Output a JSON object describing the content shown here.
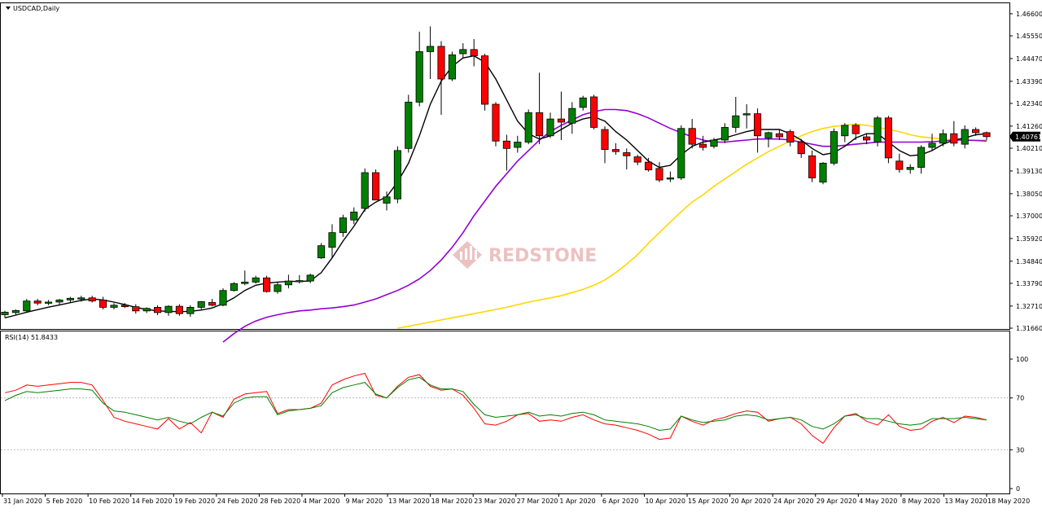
{
  "chart_title": "USDCAD,Daily",
  "rsi_label": "RSI(14) 51.8433",
  "watermark": "REDSTONE",
  "current_price": "1.40761",
  "colors": {
    "bull": "#008000",
    "bear": "#ff0000",
    "ma_fast": "#000000",
    "ma_mid": "#9400d3",
    "ma_slow": "#ffd700",
    "rsi": "#008000",
    "rsi_ma": "#ff0000",
    "watermark": "#e8a0a0"
  },
  "chart_data": [
    {
      "type": "candlestick",
      "title": "USDCAD,Daily",
      "ylim": [
        1.3166,
        1.4706
      ],
      "y_ticks": [
        "1.46600",
        "1.45550",
        "1.44470",
        "1.43390",
        "1.42340",
        "1.41260",
        "1.40210",
        "1.39130",
        "1.38050",
        "1.37000",
        "1.35920",
        "1.34840",
        "1.33790",
        "1.32710",
        "1.31660"
      ],
      "x_ticks": [
        "31 Jan 2020",
        "5 Feb 2020",
        "10 Feb 2020",
        "14 Feb 2020",
        "19 Feb 2020",
        "24 Feb 2020",
        "28 Feb 2020",
        "4 Mar 2020",
        "9 Mar 2020",
        "13 Mar 2020",
        "18 Mar 2020",
        "23 Mar 2020",
        "27 Mar 2020",
        "1 Apr 2020",
        "6 Apr 2020",
        "10 Apr 2020",
        "15 Apr 2020",
        "20 Apr 2020",
        "24 Apr 2020",
        "29 Apr 2020",
        "4 May 2020",
        "8 May 2020",
        "13 May 2020",
        "18 May 2020"
      ],
      "candles": [
        {
          "o": 1.323,
          "h": 1.3248,
          "l": 1.3215,
          "c": 1.3242
        },
        {
          "o": 1.324,
          "h": 1.3255,
          "l": 1.323,
          "c": 1.325
        },
        {
          "o": 1.3248,
          "h": 1.3305,
          "l": 1.324,
          "c": 1.3295
        },
        {
          "o": 1.3295,
          "h": 1.3305,
          "l": 1.3275,
          "c": 1.3285
        },
        {
          "o": 1.3285,
          "h": 1.33,
          "l": 1.3275,
          "c": 1.329
        },
        {
          "o": 1.329,
          "h": 1.3305,
          "l": 1.3278,
          "c": 1.33
        },
        {
          "o": 1.33,
          "h": 1.3315,
          "l": 1.3288,
          "c": 1.3308
        },
        {
          "o": 1.3305,
          "h": 1.332,
          "l": 1.3292,
          "c": 1.331
        },
        {
          "o": 1.331,
          "h": 1.332,
          "l": 1.3288,
          "c": 1.3295
        },
        {
          "o": 1.33,
          "h": 1.3315,
          "l": 1.3255,
          "c": 1.3265
        },
        {
          "o": 1.3265,
          "h": 1.3285,
          "l": 1.3255,
          "c": 1.3275
        },
        {
          "o": 1.3275,
          "h": 1.3285,
          "l": 1.3262,
          "c": 1.3268
        },
        {
          "o": 1.3268,
          "h": 1.328,
          "l": 1.3235,
          "c": 1.3248
        },
        {
          "o": 1.3248,
          "h": 1.3265,
          "l": 1.3238,
          "c": 1.326
        },
        {
          "o": 1.3265,
          "h": 1.3275,
          "l": 1.3228,
          "c": 1.324
        },
        {
          "o": 1.324,
          "h": 1.3275,
          "l": 1.3225,
          "c": 1.327
        },
        {
          "o": 1.327,
          "h": 1.328,
          "l": 1.3225,
          "c": 1.3235
        },
        {
          "o": 1.3235,
          "h": 1.3275,
          "l": 1.322,
          "c": 1.3265
        },
        {
          "o": 1.3265,
          "h": 1.3295,
          "l": 1.3255,
          "c": 1.3292
        },
        {
          "o": 1.3288,
          "h": 1.3305,
          "l": 1.327,
          "c": 1.3275
        },
        {
          "o": 1.3275,
          "h": 1.3355,
          "l": 1.327,
          "c": 1.3345
        },
        {
          "o": 1.3345,
          "h": 1.3385,
          "l": 1.334,
          "c": 1.3378
        },
        {
          "o": 1.3378,
          "h": 1.344,
          "l": 1.337,
          "c": 1.3385
        },
        {
          "o": 1.3385,
          "h": 1.3415,
          "l": 1.3378,
          "c": 1.3405
        },
        {
          "o": 1.3405,
          "h": 1.3415,
          "l": 1.3335,
          "c": 1.334
        },
        {
          "o": 1.334,
          "h": 1.3385,
          "l": 1.333,
          "c": 1.3372
        },
        {
          "o": 1.3372,
          "h": 1.342,
          "l": 1.3355,
          "c": 1.339
        },
        {
          "o": 1.3388,
          "h": 1.3418,
          "l": 1.3378,
          "c": 1.3392
        },
        {
          "o": 1.339,
          "h": 1.3425,
          "l": 1.338,
          "c": 1.3418
        },
        {
          "o": 1.35,
          "h": 1.357,
          "l": 1.3495,
          "c": 1.3558
        },
        {
          "o": 1.355,
          "h": 1.366,
          "l": 1.35,
          "c": 1.362
        },
        {
          "o": 1.362,
          "h": 1.3705,
          "l": 1.36,
          "c": 1.369
        },
        {
          "o": 1.368,
          "h": 1.374,
          "l": 1.366,
          "c": 1.3718
        },
        {
          "o": 1.3735,
          "h": 1.3925,
          "l": 1.372,
          "c": 1.3905
        },
        {
          "o": 1.3905,
          "h": 1.392,
          "l": 1.378,
          "c": 1.3775
        },
        {
          "o": 1.376,
          "h": 1.3815,
          "l": 1.3725,
          "c": 1.379
        },
        {
          "o": 1.378,
          "h": 1.403,
          "l": 1.376,
          "c": 1.401
        },
        {
          "o": 1.402,
          "h": 1.4275,
          "l": 1.4,
          "c": 1.424
        },
        {
          "o": 1.424,
          "h": 1.4575,
          "l": 1.422,
          "c": 1.448
        },
        {
          "o": 1.448,
          "h": 1.46,
          "l": 1.435,
          "c": 1.4505
        },
        {
          "o": 1.4505,
          "h": 1.453,
          "l": 1.418,
          "c": 1.435
        },
        {
          "o": 1.435,
          "h": 1.448,
          "l": 1.434,
          "c": 1.4465
        },
        {
          "o": 1.447,
          "h": 1.452,
          "l": 1.445,
          "c": 1.449
        },
        {
          "o": 1.449,
          "h": 1.454,
          "l": 1.441,
          "c": 1.446
        },
        {
          "o": 1.446,
          "h": 1.447,
          "l": 1.42,
          "c": 1.423
        },
        {
          "o": 1.423,
          "h": 1.424,
          "l": 1.403,
          "c": 1.4055
        },
        {
          "o": 1.4055,
          "h": 1.4085,
          "l": 1.3915,
          "c": 1.402
        },
        {
          "o": 1.4025,
          "h": 1.408,
          "l": 1.4,
          "c": 1.405
        },
        {
          "o": 1.405,
          "h": 1.4205,
          "l": 1.404,
          "c": 1.419
        },
        {
          "o": 1.419,
          "h": 1.438,
          "l": 1.404,
          "c": 1.408
        },
        {
          "o": 1.408,
          "h": 1.419,
          "l": 1.407,
          "c": 1.416
        },
        {
          "o": 1.416,
          "h": 1.429,
          "l": 1.406,
          "c": 1.4145
        },
        {
          "o": 1.414,
          "h": 1.424,
          "l": 1.409,
          "c": 1.421
        },
        {
          "o": 1.4215,
          "h": 1.427,
          "l": 1.42,
          "c": 1.426
        },
        {
          "o": 1.4265,
          "h": 1.4275,
          "l": 1.411,
          "c": 1.412
        },
        {
          "o": 1.411,
          "h": 1.4125,
          "l": 1.395,
          "c": 1.4015
        },
        {
          "o": 1.4015,
          "h": 1.4045,
          "l": 1.399,
          "c": 1.4005
        },
        {
          "o": 1.4,
          "h": 1.402,
          "l": 1.392,
          "c": 1.3985
        },
        {
          "o": 1.398,
          "h": 1.399,
          "l": 1.394,
          "c": 1.3955
        },
        {
          "o": 1.3955,
          "h": 1.3975,
          "l": 1.391,
          "c": 1.3918
        },
        {
          "o": 1.3925,
          "h": 1.3955,
          "l": 1.386,
          "c": 1.387
        },
        {
          "o": 1.3875,
          "h": 1.391,
          "l": 1.386,
          "c": 1.388
        },
        {
          "o": 1.388,
          "h": 1.413,
          "l": 1.387,
          "c": 1.4115
        },
        {
          "o": 1.4115,
          "h": 1.416,
          "l": 1.402,
          "c": 1.404
        },
        {
          "o": 1.404,
          "h": 1.408,
          "l": 1.401,
          "c": 1.4025
        },
        {
          "o": 1.403,
          "h": 1.407,
          "l": 1.402,
          "c": 1.406
        },
        {
          "o": 1.406,
          "h": 1.414,
          "l": 1.4045,
          "c": 1.412
        },
        {
          "o": 1.412,
          "h": 1.4265,
          "l": 1.4095,
          "c": 1.4175
        },
        {
          "o": 1.418,
          "h": 1.423,
          "l": 1.4115,
          "c": 1.4185
        },
        {
          "o": 1.4185,
          "h": 1.421,
          "l": 1.4,
          "c": 1.408
        },
        {
          "o": 1.407,
          "h": 1.41,
          "l": 1.4025,
          "c": 1.4095
        },
        {
          "o": 1.409,
          "h": 1.411,
          "l": 1.406,
          "c": 1.4075
        },
        {
          "o": 1.41,
          "h": 1.411,
          "l": 1.403,
          "c": 1.405
        },
        {
          "o": 1.405,
          "h": 1.4065,
          "l": 1.3975,
          "c": 1.3995
        },
        {
          "o": 1.3985,
          "h": 1.401,
          "l": 1.386,
          "c": 1.388
        },
        {
          "o": 1.386,
          "h": 1.3955,
          "l": 1.385,
          "c": 1.395
        },
        {
          "o": 1.395,
          "h": 1.4115,
          "l": 1.394,
          "c": 1.41
        },
        {
          "o": 1.408,
          "h": 1.414,
          "l": 1.405,
          "c": 1.413
        },
        {
          "o": 1.413,
          "h": 1.414,
          "l": 1.406,
          "c": 1.409
        },
        {
          "o": 1.4075,
          "h": 1.409,
          "l": 1.404,
          "c": 1.406
        },
        {
          "o": 1.405,
          "h": 1.4175,
          "l": 1.403,
          "c": 1.4165
        },
        {
          "o": 1.4165,
          "h": 1.4175,
          "l": 1.395,
          "c": 1.3975
        },
        {
          "o": 1.396,
          "h": 1.3995,
          "l": 1.3905,
          "c": 1.392
        },
        {
          "o": 1.392,
          "h": 1.3945,
          "l": 1.39,
          "c": 1.393
        },
        {
          "o": 1.393,
          "h": 1.4035,
          "l": 1.39,
          "c": 1.4025
        },
        {
          "o": 1.4025,
          "h": 1.409,
          "l": 1.401,
          "c": 1.4045
        },
        {
          "o": 1.4045,
          "h": 1.411,
          "l": 1.403,
          "c": 1.409
        },
        {
          "o": 1.409,
          "h": 1.415,
          "l": 1.403,
          "c": 1.4045
        },
        {
          "o": 1.404,
          "h": 1.413,
          "l": 1.402,
          "c": 1.411
        },
        {
          "o": 1.411,
          "h": 1.412,
          "l": 1.408,
          "c": 1.4095
        },
        {
          "o": 1.4095,
          "h": 1.41,
          "l": 1.406,
          "c": 1.4076
        }
      ],
      "ma_fast": [
        1.3215,
        1.3228,
        1.3242,
        1.3254,
        1.3266,
        1.3276,
        1.3287,
        1.3298,
        1.3305,
        1.33,
        1.329,
        1.3278,
        1.3265,
        1.3255,
        1.3248,
        1.3246,
        1.3244,
        1.3246,
        1.3252,
        1.3262,
        1.3282,
        1.331,
        1.3345,
        1.337,
        1.338,
        1.3385,
        1.3388,
        1.3388,
        1.339,
        1.343,
        1.35,
        1.358,
        1.365,
        1.373,
        1.3765,
        1.379,
        1.386,
        1.395,
        1.408,
        1.423,
        1.434,
        1.441,
        1.445,
        1.446,
        1.443,
        1.435,
        1.425,
        1.415,
        1.409,
        1.4065,
        1.408,
        1.411,
        1.414,
        1.416,
        1.417,
        1.415,
        1.41,
        1.406,
        1.401,
        1.396,
        1.393,
        1.394,
        1.399,
        1.403,
        1.405,
        1.406,
        1.407,
        1.4085,
        1.41,
        1.411,
        1.411,
        1.411,
        1.409,
        1.406,
        1.402,
        1.399,
        1.4,
        1.403,
        1.407,
        1.409,
        1.409,
        1.405,
        1.401,
        1.3985,
        1.399,
        1.401,
        1.404,
        1.406,
        1.407,
        1.4085,
        1.409
      ],
      "ma_mid": [
        null,
        null,
        null,
        null,
        null,
        null,
        null,
        null,
        null,
        null,
        null,
        null,
        null,
        null,
        null,
        null,
        null,
        null,
        null,
        null,
        1.31,
        1.314,
        1.3175,
        1.32,
        1.3218,
        1.323,
        1.324,
        1.3248,
        1.3252,
        1.3258,
        1.3262,
        1.3268,
        1.3276,
        1.329,
        1.3305,
        1.3325,
        1.3345,
        1.337,
        1.34,
        1.344,
        1.349,
        1.355,
        1.362,
        1.37,
        1.377,
        1.384,
        1.39,
        1.396,
        1.401,
        1.406,
        1.41,
        1.413,
        1.4155,
        1.418,
        1.4195,
        1.4205,
        1.4205,
        1.42,
        1.4185,
        1.4165,
        1.414,
        1.4115,
        1.4095,
        1.4075,
        1.406,
        1.405,
        1.405,
        1.4055,
        1.406,
        1.4065,
        1.4065,
        1.4065,
        1.406,
        1.405,
        1.404,
        1.403,
        1.403,
        1.4035,
        1.404,
        1.4045,
        1.405,
        1.405,
        1.405,
        1.405,
        1.405,
        1.4052,
        1.4055,
        1.406,
        1.406,
        1.4058,
        1.4055
      ],
      "ma_slow": [
        null,
        null,
        null,
        null,
        null,
        null,
        null,
        null,
        null,
        null,
        null,
        null,
        null,
        null,
        null,
        null,
        null,
        null,
        null,
        null,
        null,
        null,
        null,
        null,
        null,
        null,
        null,
        null,
        null,
        null,
        null,
        null,
        null,
        null,
        null,
        null,
        1.3166,
        1.3175,
        1.3185,
        1.3195,
        1.3205,
        1.3215,
        1.3225,
        1.3235,
        1.3245,
        1.3255,
        1.3265,
        1.3278,
        1.329,
        1.33,
        1.331,
        1.332,
        1.3335,
        1.335,
        1.337,
        1.3395,
        1.343,
        1.347,
        1.3515,
        1.357,
        1.362,
        1.367,
        1.372,
        1.3765,
        1.38,
        1.384,
        1.3875,
        1.391,
        1.3945,
        1.3975,
        1.4005,
        1.403,
        1.4055,
        1.408,
        1.41,
        1.4115,
        1.4125,
        1.413,
        1.4135,
        1.413,
        1.412,
        1.411,
        1.41,
        1.4085,
        1.4075,
        1.407,
        1.4065,
        1.406,
        1.406,
        1.406,
        1.406
      ]
    },
    {
      "type": "line",
      "title": "RSI(14) 51.8433",
      "ylim": [
        0,
        100
      ],
      "y_ticks": [
        100,
        70,
        30,
        0
      ],
      "series": [
        {
          "name": "RSI(14)",
          "values": [
            68,
            72,
            75,
            74,
            75,
            76,
            77,
            77,
            76,
            66,
            60,
            59,
            57,
            55,
            53,
            55,
            52,
            50,
            55,
            59,
            56,
            66,
            70,
            71,
            71,
            57,
            60,
            61,
            62,
            64,
            74,
            78,
            80,
            82,
            73,
            70,
            78,
            84,
            86,
            80,
            77,
            77,
            75,
            65,
            57,
            55,
            56,
            57,
            59,
            56,
            57,
            56,
            58,
            59,
            57,
            53,
            52,
            51,
            50,
            48,
            45,
            46,
            56,
            53,
            51,
            52,
            53,
            56,
            57,
            56,
            53,
            54,
            55,
            53,
            48,
            46,
            50,
            56,
            57,
            54,
            54,
            52,
            50,
            49,
            50,
            54,
            54,
            54,
            55,
            54,
            53
          ]
        },
        {
          "name": "MA",
          "values": [
            74,
            76,
            80,
            79,
            80,
            81,
            82,
            82,
            80,
            68,
            55,
            52,
            50,
            48,
            46,
            54,
            46,
            51,
            43,
            59,
            55,
            69,
            73,
            74,
            75,
            58,
            61,
            61,
            62,
            66,
            80,
            84,
            87,
            89,
            72,
            70,
            79,
            86,
            88,
            79,
            76,
            77,
            72,
            62,
            50,
            49,
            52,
            57,
            58,
            52,
            53,
            52,
            55,
            57,
            53,
            50,
            49,
            47,
            45,
            42,
            38,
            39,
            56,
            52,
            49,
            53,
            55,
            58,
            60,
            59,
            52,
            54,
            55,
            50,
            41,
            35,
            47,
            56,
            58,
            52,
            49,
            57,
            48,
            45,
            46,
            52,
            55,
            51,
            56,
            55,
            53
          ]
        }
      ]
    }
  ]
}
